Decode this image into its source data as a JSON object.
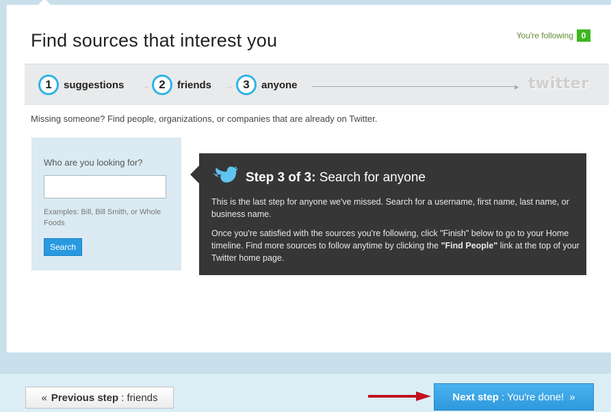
{
  "header": {
    "title": "Find sources that interest you",
    "following_label": "You're following",
    "following_count": "0"
  },
  "steps": [
    {
      "number": "1",
      "label": "suggestions"
    },
    {
      "number": "2",
      "label": "friends"
    },
    {
      "number": "3",
      "label": "anyone"
    }
  ],
  "logo": {
    "text": "twitter"
  },
  "intro": "Missing someone? Find people, organizations, or companies that are already on Twitter.",
  "search": {
    "question": "Who are you looking for?",
    "input_value": "",
    "examples": "Examples: Bill, Bill Smith, or Whole Foods",
    "button_label": "Search"
  },
  "tip": {
    "title_bold": "Step 3 of 3:",
    "title_rest": "Search for anyone",
    "paragraph1": "This is the last step for anyone we've missed. Search for a username, first name, last name, or business name.",
    "paragraph2_pre": "Once you're satisfied with the sources you're following, click \"Finish\" below to go to your Home timeline. Find more sources to follow anytime by clicking the",
    "paragraph2_bold": "\"Find People\"",
    "paragraph2_post": "link at the top of your Twitter home page."
  },
  "footer": {
    "prev_icon": "«",
    "prev_bold": "Previous step",
    "prev_rest": ": friends",
    "next_bold": "Next step",
    "next_rest": ": You're done!",
    "next_icon": "»"
  },
  "colors": {
    "accent": "#2fb3e7",
    "following_badge": "#3eb61f",
    "tip_background": "#363636",
    "next_button": "#2d99dc",
    "annotation_arrow": "#c1121f"
  }
}
